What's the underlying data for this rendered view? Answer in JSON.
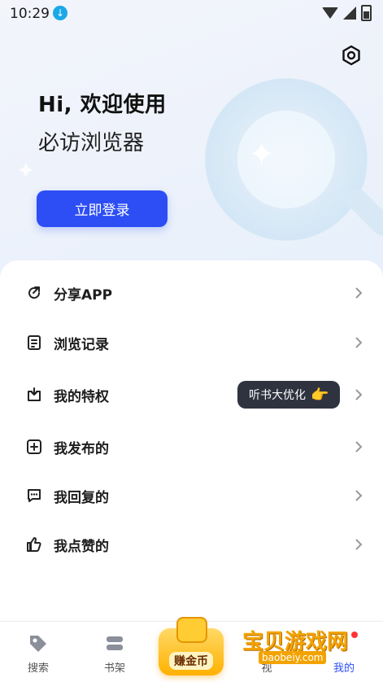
{
  "status_bar": {
    "time": "10:29"
  },
  "hero": {
    "title": "Hi, 欢迎使用",
    "subtitle": "必访浏览器",
    "login_button": "立即登录"
  },
  "menu": [
    {
      "label": "分享APP",
      "icon": "share-icon"
    },
    {
      "label": "浏览记录",
      "icon": "history-icon"
    },
    {
      "label": "我的特权",
      "icon": "privilege-icon"
    },
    {
      "label": "我发布的",
      "icon": "add-post-icon"
    },
    {
      "label": "我回复的",
      "icon": "comment-icon"
    },
    {
      "label": "我点赞的",
      "icon": "thumbs-up-icon"
    }
  ],
  "tooltip": {
    "text": "听书大优化",
    "icon": "pointing-hand-icon"
  },
  "bottom_nav": {
    "items": [
      {
        "label": "搜索",
        "icon": "tag-icon"
      },
      {
        "label": "书架",
        "icon": "bookshelf-icon"
      },
      {
        "label": "视",
        "icon": "video-icon"
      },
      {
        "label": "我的",
        "icon": "profile-icon"
      }
    ],
    "earn_button": "赚金币"
  },
  "watermark": {
    "text": "宝贝游戏网",
    "url": "baobeiy.com"
  },
  "colors": {
    "accent": "#2d4ef5",
    "tooltip_bg": "#2f3340",
    "earn": "#ffb100"
  }
}
